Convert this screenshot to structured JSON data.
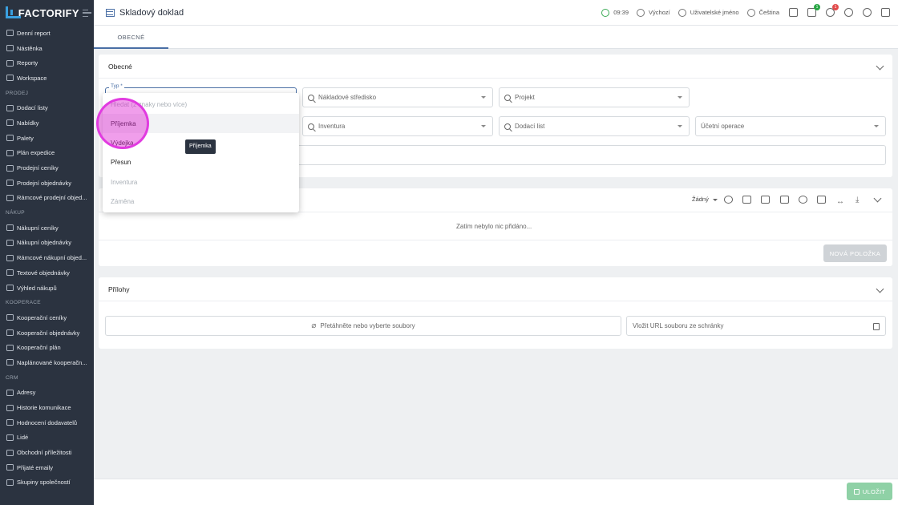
{
  "brand": {
    "name": "FACTORIFY"
  },
  "sidebar": {
    "items": [
      {
        "type": "item",
        "label": "Denní report"
      },
      {
        "type": "item",
        "label": "Nástěnka"
      },
      {
        "type": "item",
        "label": "Reporty"
      },
      {
        "type": "item",
        "label": "Workspace"
      },
      {
        "type": "section",
        "label": "PRODEJ"
      },
      {
        "type": "item",
        "label": "Dodací listy"
      },
      {
        "type": "item",
        "label": "Nabídky"
      },
      {
        "type": "item",
        "label": "Palety"
      },
      {
        "type": "item",
        "label": "Plán expedice"
      },
      {
        "type": "item",
        "label": "Prodejní ceníky"
      },
      {
        "type": "item",
        "label": "Prodejní objednávky"
      },
      {
        "type": "item",
        "label": "Rámcové prodejní objed..."
      },
      {
        "type": "section",
        "label": "NÁKUP"
      },
      {
        "type": "item",
        "label": "Nákupní ceníky"
      },
      {
        "type": "item",
        "label": "Nákupní objednávky"
      },
      {
        "type": "item",
        "label": "Rámcové nákupní objed..."
      },
      {
        "type": "item",
        "label": "Textové objednávky"
      },
      {
        "type": "item",
        "label": "Výhled nákupů"
      },
      {
        "type": "section",
        "label": "KOOPERACE"
      },
      {
        "type": "item",
        "label": "Kooperační ceníky"
      },
      {
        "type": "item",
        "label": "Kooperační objednávky"
      },
      {
        "type": "item",
        "label": "Kooperační plán"
      },
      {
        "type": "item",
        "label": "Naplánované kooperačn..."
      },
      {
        "type": "section",
        "label": "CRM"
      },
      {
        "type": "item",
        "label": "Adresy"
      },
      {
        "type": "item",
        "label": "Historie komunikace"
      },
      {
        "type": "item",
        "label": "Hodnocení dodavatelů"
      },
      {
        "type": "item",
        "label": "Lidé"
      },
      {
        "type": "item",
        "label": "Obchodní příležitosti"
      },
      {
        "type": "item",
        "label": "Přijaté emaily"
      },
      {
        "type": "item",
        "label": "Skupiny společností"
      }
    ]
  },
  "header": {
    "title": "Skladový doklad",
    "time": "09:39",
    "workspace": "Výchozí",
    "user": "Uživatelské jméno",
    "language": "Čeština",
    "gift_badge": "1",
    "bell_badge": "1"
  },
  "tabs": [
    {
      "label": "OBECNÉ"
    }
  ],
  "general": {
    "title": "Obecné",
    "type_label": "Typ *",
    "cost_center_placeholder": "Nákladové středisko",
    "project_placeholder": "Projekt",
    "inventory_placeholder": "Inventura",
    "delivery_note_placeholder": "Dodací list",
    "accounting_placeholder": "Účetní operace"
  },
  "items_panel": {
    "sort_value": "Žádný",
    "empty_text": "Zatím nebylo nic přidáno...",
    "new_item_label": "NOVÁ POLOŽKA"
  },
  "attachments": {
    "title": "Přílohy",
    "dropzone_text": "Přetáhněte nebo vyberte soubory",
    "url_placeholder": "Vložit URL souboru ze schránky"
  },
  "dropdown": {
    "search_placeholder": "Hledat (2 znaky nebo více)",
    "options": [
      {
        "label": "Příjemka",
        "highlighted": true,
        "disabled": false
      },
      {
        "label": "Výdejka",
        "highlighted": false,
        "disabled": false
      },
      {
        "label": "Přesun",
        "highlighted": false,
        "disabled": false
      },
      {
        "label": "Inventura",
        "highlighted": false,
        "disabled": true
      },
      {
        "label": "Záměna",
        "highlighted": false,
        "disabled": true
      }
    ]
  },
  "tooltip": {
    "text": "Příjemka"
  },
  "footer": {
    "save_label": "ULOŽIT"
  },
  "colors": {
    "accent": "#4a6fa5",
    "sidebar": "#2b3340",
    "save": "#8fd1a6",
    "highlight": "#e13be0"
  }
}
